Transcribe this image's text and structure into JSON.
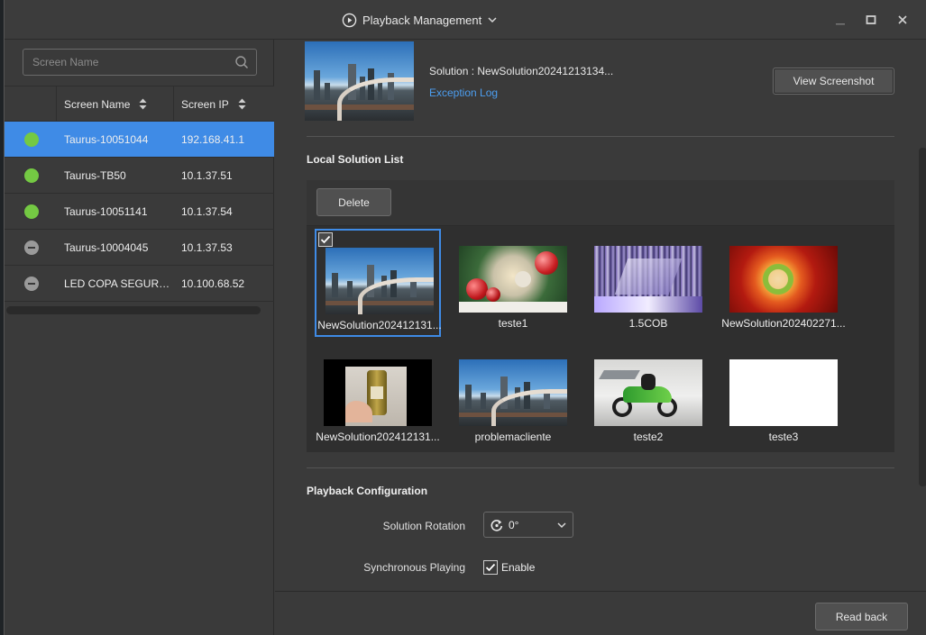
{
  "window": {
    "title": "Playback Management",
    "controls": {
      "minimize": "minimize-icon",
      "maximize": "maximize-icon",
      "close": "close-icon"
    }
  },
  "screens": {
    "search_placeholder": "Screen Name",
    "columns": {
      "name": "Screen Name",
      "ip": "Screen IP"
    },
    "rows": [
      {
        "name": "Taurus-10051044",
        "ip": "192.168.41.1",
        "status": "online",
        "selected": true
      },
      {
        "name": "Taurus-TB50",
        "ip": "10.1.37.51",
        "status": "online",
        "selected": false
      },
      {
        "name": "Taurus-10051141",
        "ip": "10.1.37.54",
        "status": "online",
        "selected": false
      },
      {
        "name": "Taurus-10004045",
        "ip": "10.1.37.53",
        "status": "offline",
        "selected": false
      },
      {
        "name": "LED COPA SEGURAN...",
        "ip": "10.100.68.52",
        "status": "offline",
        "selected": false
      }
    ]
  },
  "current": {
    "solution": "Solution : NewSolution20241213134...",
    "exception_log": "Exception Log",
    "view_screenshot": "View Screenshot"
  },
  "local_list": {
    "title": "Local Solution List",
    "delete": "Delete",
    "items": [
      {
        "label": "NewSolution202412131...",
        "thumb": "city",
        "selected": true
      },
      {
        "label": "teste1",
        "thumb": "christmas",
        "selected": false
      },
      {
        "label": "1.5COB",
        "thumb": "glitch",
        "selected": false
      },
      {
        "label": "NewSolution202402271...",
        "thumb": "red-circle",
        "selected": false
      },
      {
        "label": "NewSolution202412131...",
        "thumb": "bottle",
        "selected": false
      },
      {
        "label": "problemacliente",
        "thumb": "city",
        "selected": false
      },
      {
        "label": "teste2",
        "thumb": "motorbike",
        "selected": false
      },
      {
        "label": "teste3",
        "thumb": "white",
        "selected": false
      }
    ]
  },
  "config": {
    "title": "Playback Configuration",
    "rotation_label": "Solution Rotation",
    "rotation_value": "0°",
    "sync_label": "Synchronous Playing",
    "sync_option": "Enable",
    "sync_checked": true
  },
  "footer": {
    "read_back": "Read back"
  },
  "colors": {
    "accent": "#3f8be6",
    "online": "#74c943",
    "offline": "#9a9a9a",
    "link": "#4c9ef0"
  }
}
